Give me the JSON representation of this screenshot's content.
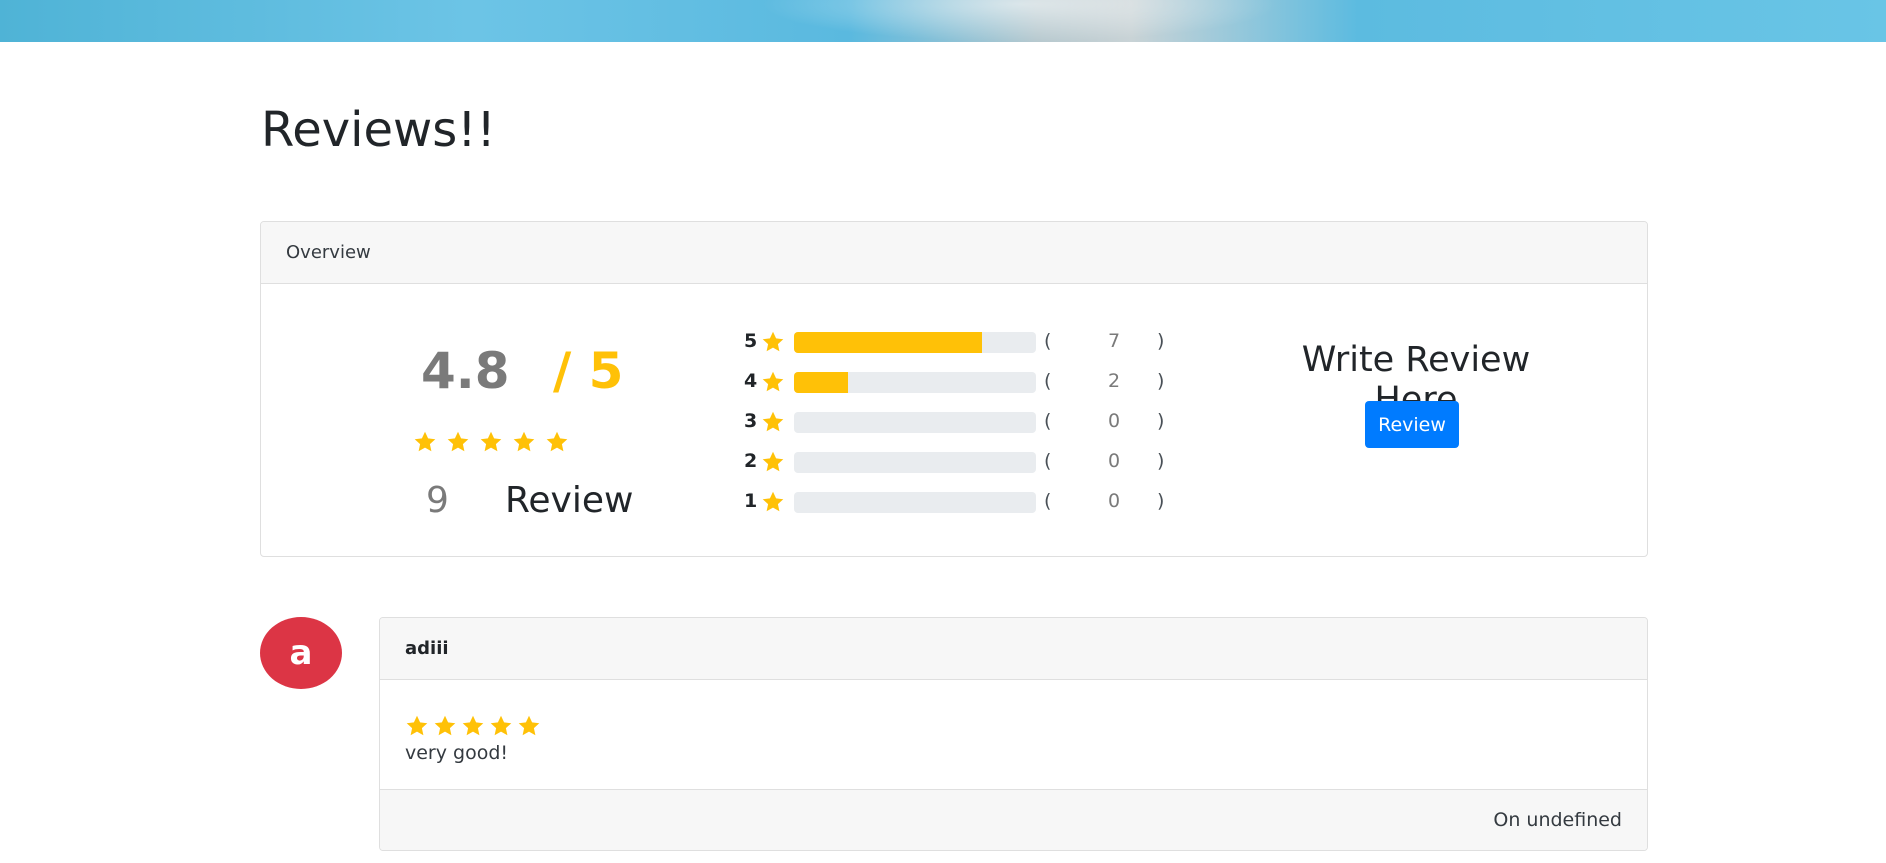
{
  "page": {
    "title": "Reviews!!"
  },
  "overview": {
    "header": "Overview",
    "average_rating": "4.8",
    "out_of": "/ 5",
    "average_stars_filled": 5,
    "total_reviews": "9",
    "reviews_label": "Review",
    "breakdown": [
      {
        "stars": "5",
        "count": "7",
        "fraction": 0.778
      },
      {
        "stars": "4",
        "count": "2",
        "fraction": 0.222
      },
      {
        "stars": "3",
        "count": "0",
        "fraction": 0
      },
      {
        "stars": "2",
        "count": "0",
        "fraction": 0
      },
      {
        "stars": "1",
        "count": "0",
        "fraction": 0
      }
    ],
    "open_paren": "(",
    "close_paren": ")",
    "write_review_title": "Write Review Here",
    "write_review_button": "Review"
  },
  "reviews": [
    {
      "avatar_letter": "a",
      "user": "adiii",
      "stars": 5,
      "text": "very good!",
      "date_text": "On undefined"
    }
  ],
  "colors": {
    "star": "#ffc107",
    "progress_track": "#e9ecef",
    "button": "#007bff",
    "avatar": "#dc3545"
  },
  "icons": {
    "star": "star-icon"
  }
}
